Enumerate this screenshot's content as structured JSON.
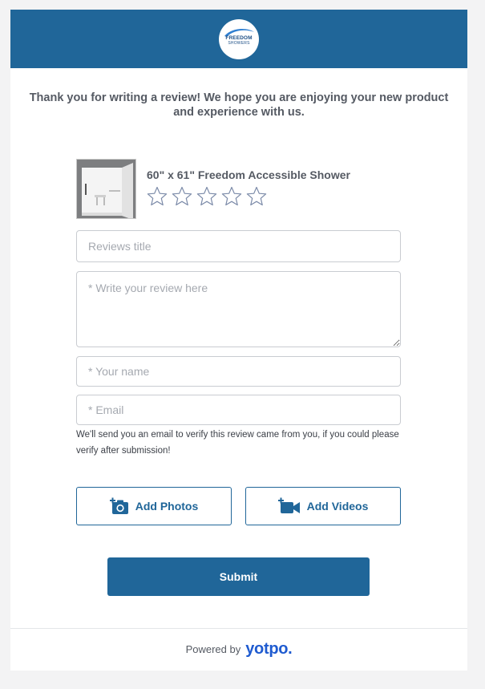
{
  "header": {
    "logo_line1": "FREEDOM",
    "logo_line2": "SHOWERS",
    "background_color": "#206699"
  },
  "intro_text": "Thank you for writing a review! We hope you are enjoying your new product and experience with us.",
  "product": {
    "name": "60\" x 61\" Freedom Accessible Shower",
    "rating_max": 5,
    "rating_selected": 0
  },
  "form": {
    "title_placeholder": "Reviews title",
    "review_placeholder": "* Write your review here",
    "name_placeholder": "* Your name",
    "email_placeholder": "* Email",
    "email_note": "We'll send you an email to verify this review came from you, if you could please verify after submission!"
  },
  "buttons": {
    "add_photos": "Add Photos",
    "add_videos": "Add Videos",
    "submit": "Submit",
    "accent_color": "#206699"
  },
  "footer": {
    "powered_by": "Powered by",
    "brand": "yotpo."
  }
}
